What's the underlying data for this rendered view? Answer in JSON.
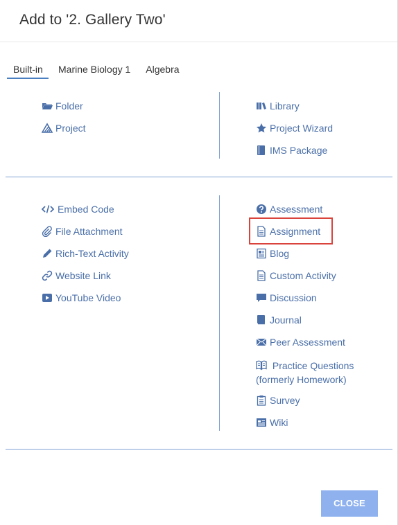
{
  "dialog": {
    "title": "Add to '2. Gallery Two'"
  },
  "tabs": [
    {
      "label": "Built-in"
    },
    {
      "label": "Marine Biology 1"
    },
    {
      "label": "Algebra"
    }
  ],
  "containers": {
    "left": [
      {
        "label": "Folder",
        "icon": "folder-icon"
      },
      {
        "label": "Project",
        "icon": "project-icon"
      }
    ],
    "right": [
      {
        "label": "Library",
        "icon": "library-icon"
      },
      {
        "label": "Project Wizard",
        "icon": "star-icon"
      },
      {
        "label": "IMS Package",
        "icon": "book-icon"
      }
    ]
  },
  "materials": {
    "left": [
      {
        "label": "Embed Code",
        "icon": "code-icon"
      },
      {
        "label": "File Attachment",
        "icon": "paperclip-icon"
      },
      {
        "label": "Rich-Text Activity",
        "icon": "pencil-icon"
      },
      {
        "label": "Website Link",
        "icon": "link-icon"
      },
      {
        "label": "YouTube Video",
        "icon": "youtube-icon"
      }
    ],
    "right": [
      {
        "label": "Assessment",
        "icon": "question-icon"
      },
      {
        "label": "Assignment",
        "icon": "document-icon"
      },
      {
        "label": "Blog",
        "icon": "blog-icon"
      },
      {
        "label": "Custom Activity",
        "icon": "document-icon"
      },
      {
        "label": "Discussion",
        "icon": "chat-icon"
      },
      {
        "label": "Journal",
        "icon": "journal-icon"
      },
      {
        "label": "Peer Assessment",
        "icon": "envelope-icon"
      },
      {
        "label": "Practice Questions (formerly Homework)",
        "icon": "open-book-icon"
      },
      {
        "label": "Survey",
        "icon": "clipboard-icon"
      },
      {
        "label": "Wiki",
        "icon": "wiki-icon"
      }
    ]
  },
  "footer": {
    "close_label": "CLOSE"
  },
  "colors": {
    "link": "#4a6fa8",
    "accent": "#4a7fc1",
    "highlight": "#d9433b",
    "button": "#8fb2ef"
  }
}
